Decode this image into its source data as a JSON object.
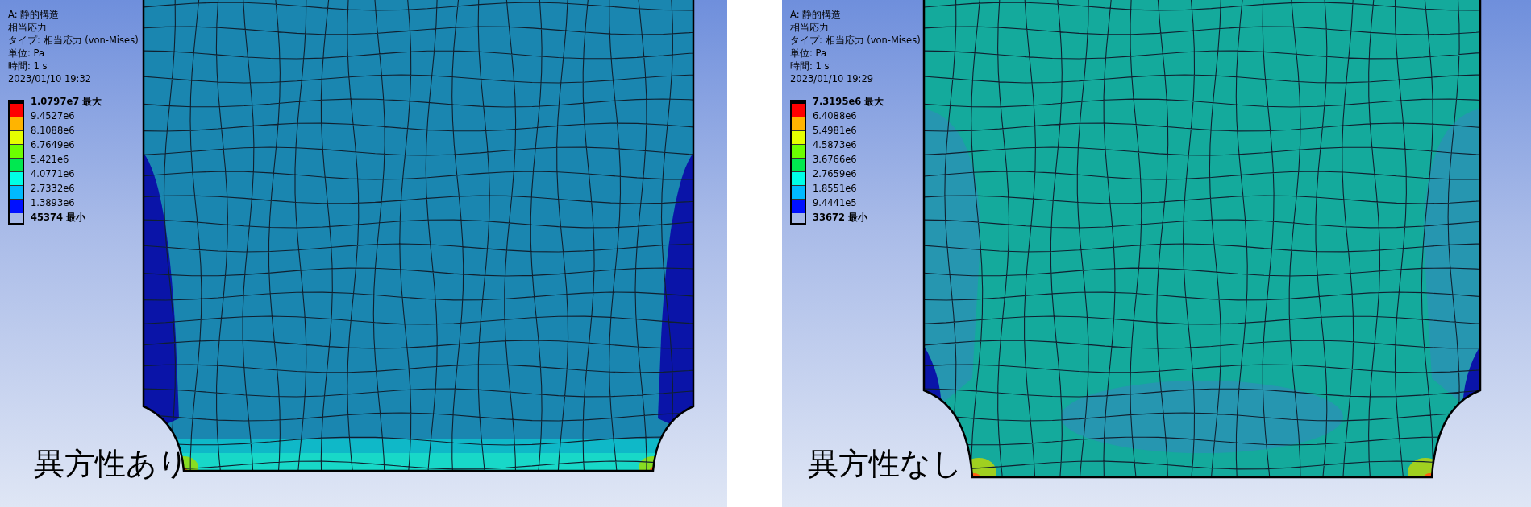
{
  "panels": [
    {
      "caption": "異方性あり",
      "color": "#1a86b0",
      "kind": "anisotropic",
      "legend": {
        "lines": [
          "A: 静的構造",
          "相当応力",
          "タイプ: 相当応力 (von-Mises)",
          "単位: Pa",
          "時間: 1 s",
          "2023/01/10 19:32"
        ],
        "values": [
          {
            "label": "1.0797e7 最大",
            "kind": "max"
          },
          {
            "label": "9.4527e6",
            "kind": "value"
          },
          {
            "label": "8.1088e6",
            "kind": "value"
          },
          {
            "label": "6.7649e6",
            "kind": "value"
          },
          {
            "label": "5.421e6",
            "kind": "value"
          },
          {
            "label": "4.0771e6",
            "kind": "value"
          },
          {
            "label": "2.7332e6",
            "kind": "value"
          },
          {
            "label": "1.3893e6",
            "kind": "value"
          },
          {
            "label": "45374 最小",
            "kind": "min"
          }
        ],
        "bands": [
          {
            "color": "#ff0000"
          },
          {
            "color": "#ffb400"
          },
          {
            "color": "#e6ff00"
          },
          {
            "color": "#6cff00"
          },
          {
            "color": "#00e850"
          },
          {
            "color": "#00ffe6"
          },
          {
            "color": "#00baff"
          },
          {
            "color": "#0010ff"
          }
        ]
      }
    },
    {
      "caption": "異方性なし",
      "color": "#14aa9c",
      "kind": "isotropic",
      "legend": {
        "lines": [
          "A: 静的構造",
          "相当応力",
          "タイプ: 相当応力 (von-Mises)",
          "単位: Pa",
          "時間: 1 s",
          "2023/01/10 19:29"
        ],
        "values": [
          {
            "label": "7.3195e6 最大",
            "kind": "max"
          },
          {
            "label": "6.4088e6",
            "kind": "value"
          },
          {
            "label": "5.4981e6",
            "kind": "value"
          },
          {
            "label": "4.5873e6",
            "kind": "value"
          },
          {
            "label": "3.6766e6",
            "kind": "value"
          },
          {
            "label": "2.7659e6",
            "kind": "value"
          },
          {
            "label": "1.8551e6",
            "kind": "value"
          },
          {
            "label": "9.4441e5",
            "kind": "value"
          },
          {
            "label": "33672 最小",
            "kind": "min"
          }
        ],
        "bands": [
          {
            "color": "#ff0000"
          },
          {
            "color": "#ffb400"
          },
          {
            "color": "#e6ff00"
          },
          {
            "color": "#6cff00"
          },
          {
            "color": "#00e850"
          },
          {
            "color": "#00ffe6"
          },
          {
            "color": "#00baff"
          },
          {
            "color": "#0010ff"
          }
        ]
      }
    }
  ]
}
